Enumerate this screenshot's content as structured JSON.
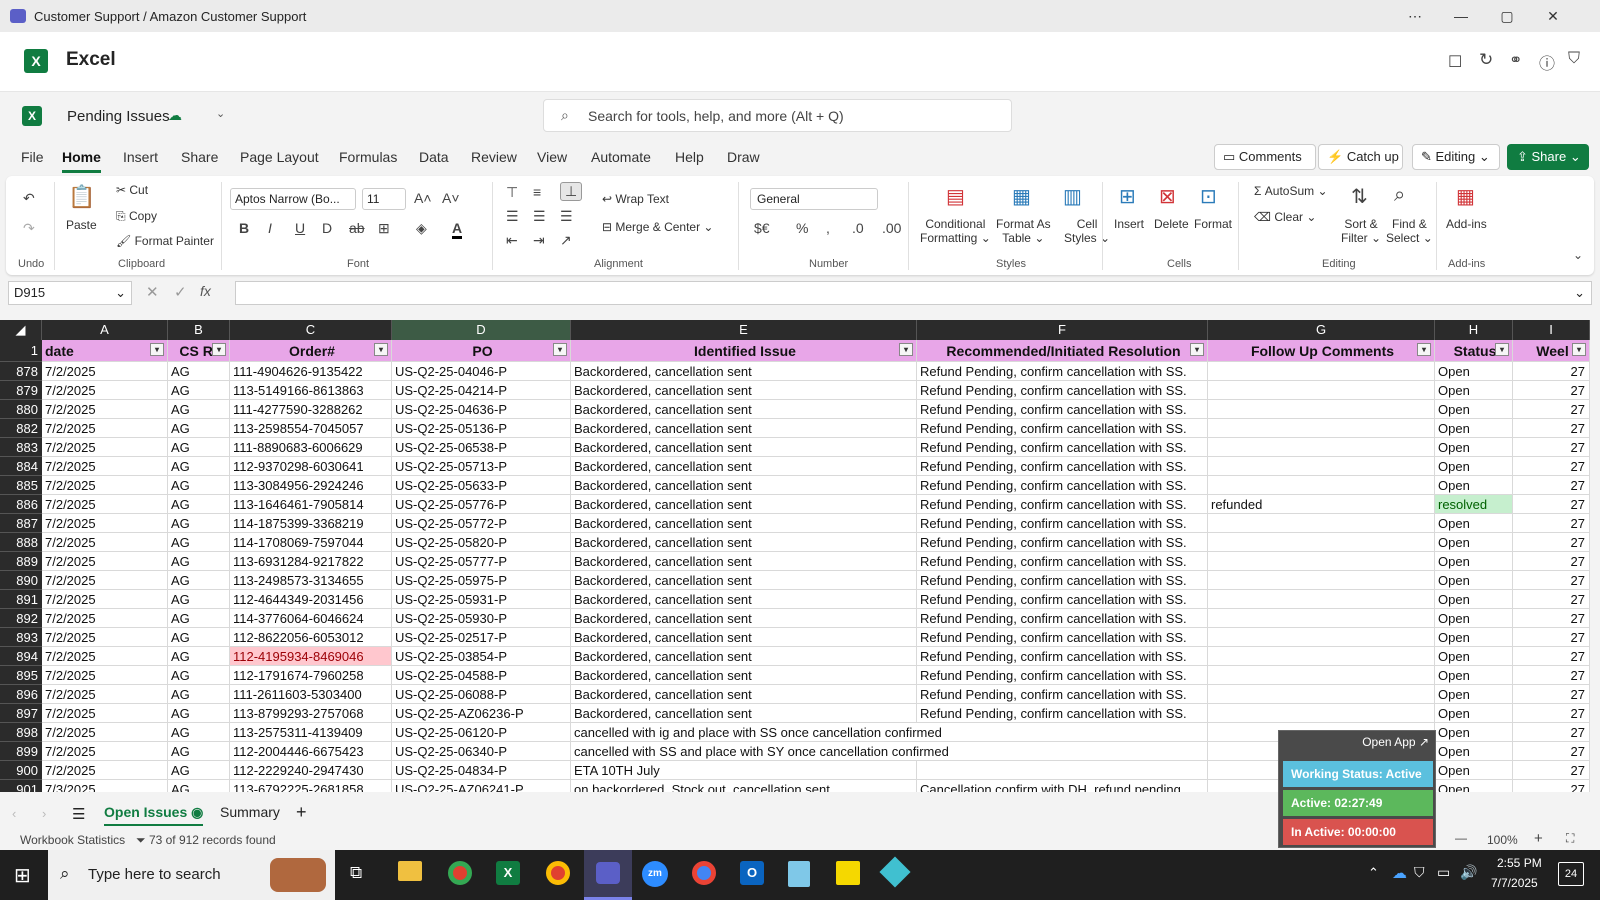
{
  "window": {
    "title": "Customer Support / Amazon Customer Support"
  },
  "app": {
    "name": "Excel"
  },
  "doc": {
    "name": "Pending Issues",
    "search_placeholder": "Search for tools, help, and more (Alt + Q)"
  },
  "tabs": [
    "File",
    "Home",
    "Insert",
    "Share",
    "Page Layout",
    "Formulas",
    "Data",
    "Review",
    "View",
    "Automate",
    "Help",
    "Draw"
  ],
  "actions": {
    "comments": "Comments",
    "catchup": "Catch up",
    "editing": "Editing",
    "share": "Share"
  },
  "ribbon": {
    "undo_label": "Undo",
    "paste": "Paste",
    "cut": "Cut",
    "copy": "Copy",
    "format_painter": "Format Painter",
    "clipboard": "Clipboard",
    "font_name": "Aptos Narrow (Bo...",
    "font_size": "11",
    "font": "Font",
    "wrap_text": "Wrap Text",
    "merge_center": "Merge & Center",
    "alignment": "Alignment",
    "number_format": "General",
    "number": "Number",
    "conditional1": "Conditional",
    "conditional2": "Formatting",
    "format_as1": "Format As",
    "format_as2": "Table",
    "cell_styles1": "Cell",
    "cell_styles2": "Styles",
    "styles": "Styles",
    "insert": "Insert",
    "delete": "Delete",
    "format": "Format",
    "cells": "Cells",
    "autosum": "AutoSum",
    "clear": "Clear",
    "sort1": "Sort &",
    "sort2": "Filter",
    "find1": "Find &",
    "find2": "Select",
    "editing": "Editing",
    "addins": "Add-ins",
    "addins_group": "Add-ins"
  },
  "formula_bar": {
    "name_box": "D915",
    "formula": ""
  },
  "columns": [
    {
      "letter": "A",
      "header": "date"
    },
    {
      "letter": "B",
      "header": "CS Re"
    },
    {
      "letter": "C",
      "header": "Order#"
    },
    {
      "letter": "D",
      "header": "PO"
    },
    {
      "letter": "E",
      "header": "Identified Issue"
    },
    {
      "letter": "F",
      "header": "Recommended/Initiated Resolution"
    },
    {
      "letter": "G",
      "header": "Follow Up Comments"
    },
    {
      "letter": "H",
      "header": "Status"
    },
    {
      "letter": "I",
      "header": "Weel"
    }
  ],
  "header_row_num": "1",
  "rows": [
    {
      "n": "878",
      "a": "7/2/2025",
      "b": "AG",
      "c": "111-4904626-9135422",
      "d": "US-Q2-25-04046-P",
      "e": "Backordered, cancellation sent",
      "f": "Refund Pending, confirm cancellation with SS.",
      "g": "",
      "h": "Open",
      "i": "27"
    },
    {
      "n": "879",
      "a": "7/2/2025",
      "b": "AG",
      "c": "113-5149166-8613863",
      "d": "US-Q2-25-04214-P",
      "e": "Backordered, cancellation sent",
      "f": "Refund Pending, confirm cancellation with SS.",
      "g": "",
      "h": "Open",
      "i": "27"
    },
    {
      "n": "880",
      "a": "7/2/2025",
      "b": "AG",
      "c": "111-4277590-3288262",
      "d": "US-Q2-25-04636-P",
      "e": "Backordered, cancellation sent",
      "f": "Refund Pending, confirm cancellation with SS.",
      "g": "",
      "h": "Open",
      "i": "27"
    },
    {
      "n": "882",
      "a": "7/2/2025",
      "b": "AG",
      "c": "113-2598554-7045057",
      "d": "US-Q2-25-05136-P",
      "e": "Backordered, cancellation sent",
      "f": "Refund Pending, confirm cancellation with SS.",
      "g": "",
      "h": "Open",
      "i": "27"
    },
    {
      "n": "883",
      "a": "7/2/2025",
      "b": "AG",
      "c": "111-8890683-6006629",
      "d": "US-Q2-25-06538-P",
      "e": "Backordered, cancellation sent",
      "f": "Refund Pending, confirm cancellation with SS.",
      "g": "",
      "h": "Open",
      "i": "27"
    },
    {
      "n": "884",
      "a": "7/2/2025",
      "b": "AG",
      "c": "112-9370298-6030641",
      "d": "US-Q2-25-05713-P",
      "e": "Backordered, cancellation sent",
      "f": "Refund Pending, confirm cancellation with SS.",
      "g": "",
      "h": "Open",
      "i": "27"
    },
    {
      "n": "885",
      "a": "7/2/2025",
      "b": "AG",
      "c": "113-3084956-2924246",
      "d": "US-Q2-25-05633-P",
      "e": "Backordered, cancellation sent",
      "f": "Refund Pending, confirm cancellation with SS.",
      "g": "",
      "h": "Open",
      "i": "27"
    },
    {
      "n": "886",
      "a": "7/2/2025",
      "b": "AG",
      "c": "113-1646461-7905814",
      "d": "US-Q2-25-05776-P",
      "e": "Backordered, cancellation sent",
      "f": "Refund Pending, confirm cancellation with SS.",
      "g": "refunded",
      "h": "resolved",
      "i": "27"
    },
    {
      "n": "887",
      "a": "7/2/2025",
      "b": "AG",
      "c": "114-1875399-3368219",
      "d": "US-Q2-25-05772-P",
      "e": "Backordered, cancellation sent",
      "f": "Refund Pending, confirm cancellation with SS.",
      "g": "",
      "h": "Open",
      "i": "27"
    },
    {
      "n": "888",
      "a": "7/2/2025",
      "b": "AG",
      "c": "114-1708069-7597044",
      "d": "US-Q2-25-05820-P",
      "e": "Backordered, cancellation sent",
      "f": "Refund Pending, confirm cancellation with SS.",
      "g": "",
      "h": "Open",
      "i": "27"
    },
    {
      "n": "889",
      "a": "7/2/2025",
      "b": "AG",
      "c": "113-6931284-9217822",
      "d": "US-Q2-25-05777-P",
      "e": "Backordered, cancellation sent",
      "f": "Refund Pending, confirm cancellation with SS.",
      "g": "",
      "h": "Open",
      "i": "27"
    },
    {
      "n": "890",
      "a": "7/2/2025",
      "b": "AG",
      "c": "113-2498573-3134655",
      "d": "US-Q2-25-05975-P",
      "e": "Backordered, cancellation sent",
      "f": "Refund Pending, confirm cancellation with SS.",
      "g": "",
      "h": "Open",
      "i": "27"
    },
    {
      "n": "891",
      "a": "7/2/2025",
      "b": "AG",
      "c": "112-4644349-2031456",
      "d": "US-Q2-25-05931-P",
      "e": "Backordered, cancellation sent",
      "f": "Refund Pending, confirm cancellation with SS.",
      "g": "",
      "h": "Open",
      "i": "27"
    },
    {
      "n": "892",
      "a": "7/2/2025",
      "b": "AG",
      "c": "114-3776064-6046624",
      "d": "US-Q2-25-05930-P",
      "e": "Backordered, cancellation sent",
      "f": "Refund Pending, confirm cancellation with SS.",
      "g": "",
      "h": "Open",
      "i": "27"
    },
    {
      "n": "893",
      "a": "7/2/2025",
      "b": "AG",
      "c": "112-8622056-6053012",
      "d": "US-Q2-25-02517-P",
      "e": "Backordered, cancellation sent",
      "f": "Refund Pending, confirm cancellation with SS.",
      "g": "",
      "h": "Open",
      "i": "27"
    },
    {
      "n": "894",
      "a": "7/2/2025",
      "b": "AG",
      "c": "112-4195934-8469046",
      "d": "US-Q2-25-03854-P",
      "e": "Backordered, cancellation sent",
      "f": "Refund Pending, confirm cancellation with SS.",
      "g": "",
      "h": "Open",
      "i": "27"
    },
    {
      "n": "895",
      "a": "7/2/2025",
      "b": "AG",
      "c": "112-1791674-7960258",
      "d": "US-Q2-25-04588-P",
      "e": "Backordered, cancellation sent",
      "f": "Refund Pending, confirm cancellation with SS.",
      "g": "",
      "h": "Open",
      "i": "27"
    },
    {
      "n": "896",
      "a": "7/2/2025",
      "b": "AG",
      "c": "111-2611603-5303400",
      "d": "US-Q2-25-06088-P",
      "e": "Backordered, cancellation sent",
      "f": "Refund Pending, confirm cancellation with SS.",
      "g": "",
      "h": "Open",
      "i": "27"
    },
    {
      "n": "897",
      "a": "7/2/2025",
      "b": "AG",
      "c": "113-8799293-2757068",
      "d": "US-Q2-25-AZ06236-P",
      "e": "Backordered, cancellation sent",
      "f": "Refund Pending, confirm cancellation with SS.",
      "g": "",
      "h": "Open",
      "i": "27"
    },
    {
      "n": "898",
      "a": "7/2/2025",
      "b": "AG",
      "c": "113-2575311-4139409",
      "d": "US-Q2-25-06120-P",
      "e": "cancelled with ig and place with SS once cancellation confirmed",
      "f": "",
      "g": "",
      "h": "Open",
      "i": "27"
    },
    {
      "n": "899",
      "a": "7/2/2025",
      "b": "AG",
      "c": "112-2004446-6675423",
      "d": "US-Q2-25-06340-P",
      "e": "cancelled with SS and place with SY once cancellation confirmed",
      "f": "",
      "g": "",
      "h": "Open",
      "i": "27"
    },
    {
      "n": "900",
      "a": "7/2/2025",
      "b": "AG",
      "c": "112-2229240-2947430",
      "d": "US-Q2-25-04834-P",
      "e": "ETA 10TH July",
      "f": "",
      "g": "",
      "h": "Open",
      "i": "27"
    },
    {
      "n": "901",
      "a": "7/3/2025",
      "b": "AG",
      "c": "113-6792225-2681858",
      "d": "US-Q2-25-AZ06241-P",
      "e": "on backordered, Stock out, cancellation sent",
      "f": "Cancellation confirm with DH, refund pending",
      "g": "",
      "h": "Open",
      "i": "27"
    }
  ],
  "sheets": {
    "active": "Open Issues",
    "other": "Summary"
  },
  "status": {
    "workbook_stats": "Workbook Statistics",
    "records": "73 of 912 records found",
    "zoom": "100%"
  },
  "widget": {
    "open_app": "Open App",
    "working": "Working Status: Active",
    "active": "Active: 02:27:49",
    "inactive": "In Active: 00:00:00"
  },
  "taskbar": {
    "search_placeholder": "Type here to search",
    "time": "2:55 PM",
    "date": "7/7/2025",
    "notif": "24"
  },
  "colors": {
    "header_pink": "#e8a6e8",
    "excel_green": "#107c41",
    "resolved_bg": "#c6efce",
    "highlight_red": "#ffc7ce"
  }
}
